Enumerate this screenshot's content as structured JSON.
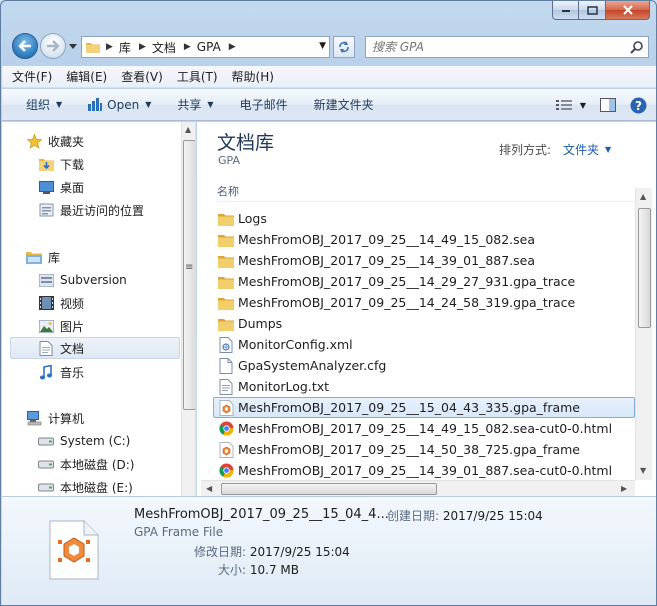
{
  "window": {
    "minimize_icon": "minimize-icon",
    "maximize_icon": "maximize-icon",
    "close_icon": "close-icon"
  },
  "address": {
    "segments": [
      "库",
      "文档",
      "GPA"
    ],
    "search_placeholder": "搜索 GPA"
  },
  "menu": [
    "文件(F)",
    "编辑(E)",
    "查看(V)",
    "工具(T)",
    "帮助(H)"
  ],
  "commands": {
    "organize": "组织",
    "open": "Open",
    "share": "共享",
    "email": "电子邮件",
    "new_folder": "新建文件夹"
  },
  "nav": {
    "favorites": "收藏夹",
    "downloads": "下载",
    "desktop": "桌面",
    "recent": "最近访问的位置",
    "libraries": "库",
    "subversion": "Subversion",
    "videos": "视频",
    "pictures": "图片",
    "documents": "文档",
    "music": "音乐",
    "computer": "计算机",
    "system_c": "System (C:)",
    "disk_d": "本地磁盘 (D:)",
    "disk_e": "本地磁盘 (E:)"
  },
  "content": {
    "title": "文档库",
    "subtitle": "GPA",
    "arrange_label": "排列方式:",
    "arrange_value": "文件夹",
    "column_name": "名称",
    "files": [
      {
        "name": "Logs",
        "icon": "folder-icon"
      },
      {
        "name": "MeshFromOBJ_2017_09_25__14_49_15_082.sea",
        "icon": "folder-icon"
      },
      {
        "name": "MeshFromOBJ_2017_09_25__14_39_01_887.sea",
        "icon": "folder-icon"
      },
      {
        "name": "MeshFromOBJ_2017_09_25__14_29_27_931.gpa_trace",
        "icon": "folder-icon"
      },
      {
        "name": "MeshFromOBJ_2017_09_25__14_24_58_319.gpa_trace",
        "icon": "folder-icon"
      },
      {
        "name": "Dumps",
        "icon": "folder-icon"
      },
      {
        "name": "MonitorConfig.xml",
        "icon": "xml-file-icon"
      },
      {
        "name": "GpaSystemAnalyzer.cfg",
        "icon": "blank-file-icon"
      },
      {
        "name": "MonitorLog.txt",
        "icon": "text-file-icon"
      },
      {
        "name": "MeshFromOBJ_2017_09_25__15_04_43_335.gpa_frame",
        "icon": "gpa-frame-icon"
      },
      {
        "name": "MeshFromOBJ_2017_09_25__14_49_15_082.sea-cut0-0.html",
        "icon": "chrome-icon"
      },
      {
        "name": "MeshFromOBJ_2017_09_25__14_50_38_725.gpa_frame",
        "icon": "gpa-frame-icon"
      },
      {
        "name": "MeshFromOBJ_2017_09_25__14_39_01_887.sea-cut0-0.html",
        "icon": "chrome-icon"
      }
    ]
  },
  "details": {
    "name": "MeshFromOBJ_2017_09_25__15_04_4...",
    "type": "GPA Frame File",
    "created_label": "创建日期:",
    "created_value": "2017/9/25 15:04",
    "modified_label": "修改日期:",
    "modified_value": "2017/9/25 15:04",
    "size_label": "大小:",
    "size_value": "10.7 MB"
  }
}
